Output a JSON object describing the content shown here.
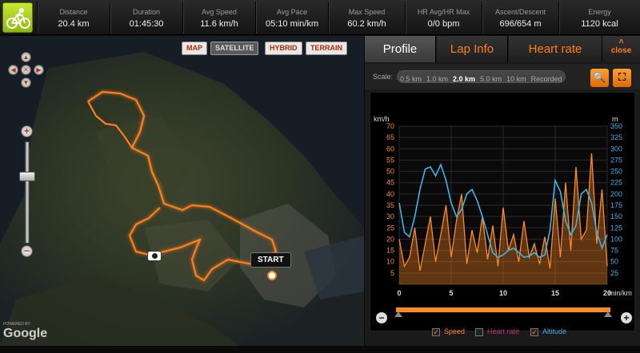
{
  "stats": [
    {
      "label": "Distance",
      "value": "20.4 km"
    },
    {
      "label": "Duration",
      "value": "01:45:30"
    },
    {
      "label": "Avg Speed",
      "value": "11.6 km/h"
    },
    {
      "label": "Avg Pace",
      "value": "05:10 min/km"
    },
    {
      "label": "Max Speed",
      "value": "60.2 km/h"
    },
    {
      "label": "HR Avg/HR Max",
      "value": "0/0 bpm"
    },
    {
      "label": "Ascent/Descent",
      "value": "696/654 m"
    },
    {
      "label": "Energy",
      "value": "1120 kcal"
    }
  ],
  "map": {
    "types": [
      "MAP",
      "SATELLITE",
      "HYBRID",
      "TERRAIN"
    ],
    "active_type": "SATELLITE",
    "start_label": "START",
    "google_powered": "POWERED BY",
    "google_logo": "Google",
    "pan_icons": [
      "chevron-up-icon",
      "chevron-left-icon",
      "center-icon",
      "chevron-right-icon",
      "chevron-down-icon"
    ],
    "zoom_in": "+",
    "zoom_out": "−",
    "zoom_level": 0.35,
    "route_color": "#ff7e1a"
  },
  "panel": {
    "tabs": [
      "Profile",
      "Lap Info",
      "Heart rate"
    ],
    "active_tab": "Profile",
    "close_label": "close",
    "scale_label": "Scale:",
    "scale_options": [
      "0.5 km",
      "1.0 km",
      "2.0 km",
      "5.0 km",
      "10 km",
      "Recorded"
    ],
    "scale_active": "2.0 km",
    "legend": [
      {
        "label": "Speed",
        "checked": true,
        "color": "#ff8a20"
      },
      {
        "label": "Heart rate",
        "checked": false,
        "color": "#c0307a"
      },
      {
        "label": "Altitude",
        "checked": true,
        "color": "#3cb4e6"
      }
    ]
  },
  "chart_data": {
    "type": "line",
    "y_left_label": "km/h",
    "y_right_label": "m",
    "x_label": "min/km",
    "y_left_ticks": [
      5,
      10,
      15,
      20,
      25,
      30,
      35,
      40,
      45,
      50,
      55,
      60,
      65,
      70
    ],
    "y_right_ticks": [
      25,
      50,
      75,
      100,
      125,
      150,
      175,
      200,
      225,
      250,
      275,
      300,
      325,
      350
    ],
    "x_ticks": [
      0,
      5,
      10,
      15,
      20
    ],
    "ylim_left": [
      0,
      70
    ],
    "ylim_right": [
      0,
      350
    ],
    "xlim": [
      0,
      20
    ],
    "series": [
      {
        "name": "Speed",
        "color": "#ff8a20",
        "x": [
          0,
          0.5,
          1,
          1.5,
          2,
          2.5,
          3,
          3.5,
          4,
          4.5,
          5,
          5.5,
          6,
          6.5,
          7,
          7.5,
          8,
          8.5,
          9,
          9.5,
          10,
          10.5,
          11,
          11.5,
          12,
          12.5,
          13,
          13.5,
          14,
          14.5,
          15,
          15.5,
          16,
          16.5,
          17,
          17.5,
          18,
          18.5,
          19,
          19.5,
          20
        ],
        "values": [
          20,
          8,
          12,
          25,
          6,
          18,
          30,
          10,
          22,
          35,
          12,
          28,
          40,
          9,
          24,
          14,
          30,
          11,
          26,
          8,
          34,
          15,
          22,
          10,
          28,
          12,
          18,
          9,
          21,
          7,
          38,
          12,
          45,
          15,
          52,
          20,
          24,
          58,
          18,
          42,
          8
        ]
      },
      {
        "name": "Altitude",
        "color": "#3cb4e6",
        "x": [
          0,
          0.5,
          1,
          1.5,
          2,
          2.5,
          3,
          3.5,
          4,
          4.5,
          5,
          5.5,
          6,
          6.5,
          7,
          7.5,
          8,
          8.5,
          9,
          9.5,
          10,
          10.5,
          11,
          11.5,
          12,
          12.5,
          13,
          13.5,
          14,
          14.5,
          15,
          15.5,
          16,
          16.5,
          17,
          17.5,
          18,
          18.5,
          19,
          19.5,
          20
        ],
        "values": [
          180,
          115,
          105,
          150,
          210,
          255,
          260,
          240,
          265,
          230,
          180,
          150,
          165,
          200,
          210,
          185,
          150,
          110,
          70,
          60,
          65,
          75,
          80,
          70,
          60,
          62,
          70,
          60,
          65,
          120,
          230,
          205,
          140,
          110,
          130,
          200,
          210,
          180,
          115,
          80,
          110
        ]
      }
    ],
    "grid": true,
    "range_slider": [
      0,
      1
    ]
  }
}
